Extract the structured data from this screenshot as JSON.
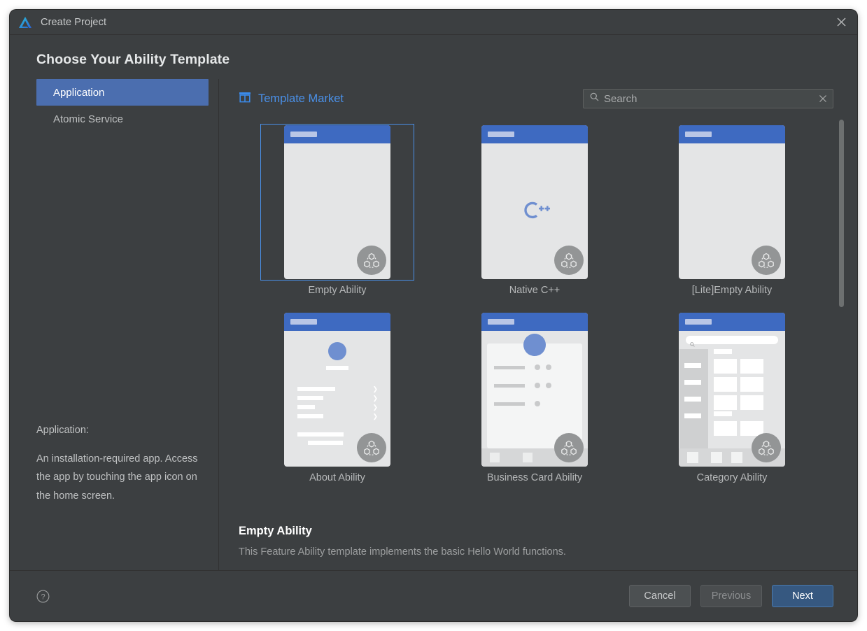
{
  "window": {
    "title": "Create Project",
    "logo_icon": "deveco-logo-icon",
    "close_icon": "close-icon"
  },
  "page_title": "Choose Your Ability Template",
  "sidebar": {
    "items": [
      {
        "label": "Application",
        "selected": true
      },
      {
        "label": "Atomic Service",
        "selected": false
      }
    ],
    "description_label": "Application:",
    "description_body": "An installation-required app. Access the app by touching the app icon on the home screen."
  },
  "market": {
    "icon": "store-icon",
    "label": "Template Market"
  },
  "search": {
    "icon": "search-icon",
    "placeholder": "Search",
    "value": "",
    "clear_icon": "close-icon"
  },
  "templates": [
    {
      "label": "Empty Ability",
      "kind": "empty",
      "selected": true,
      "badge": "harmonyos-badge-icon"
    },
    {
      "label": "Native C++",
      "kind": "cpp",
      "selected": false,
      "badge": "harmonyos-badge-icon",
      "glyph": "C++"
    },
    {
      "label": "[Lite]Empty Ability",
      "kind": "empty",
      "selected": false,
      "badge": "harmonyos-badge-icon"
    },
    {
      "label": "About Ability",
      "kind": "about",
      "selected": false,
      "badge": "harmonyos-badge-icon"
    },
    {
      "label": "Business Card Ability",
      "kind": "business",
      "selected": false,
      "badge": "harmonyos-badge-icon"
    },
    {
      "label": "Category Ability",
      "kind": "category",
      "selected": false,
      "badge": "harmonyos-badge-icon"
    }
  ],
  "detail": {
    "title": "Empty Ability",
    "description": "This Feature Ability template implements the basic Hello World functions."
  },
  "footer": {
    "help_icon": "help-icon",
    "cancel_label": "Cancel",
    "previous_label": "Previous",
    "next_label": "Next"
  },
  "colors": {
    "window_bg": "#3c3f41",
    "accent_blue": "#4a90e8",
    "selection_blue": "#4b6eaf",
    "primary_button": "#365880",
    "phone_header": "#3e6ac1"
  }
}
